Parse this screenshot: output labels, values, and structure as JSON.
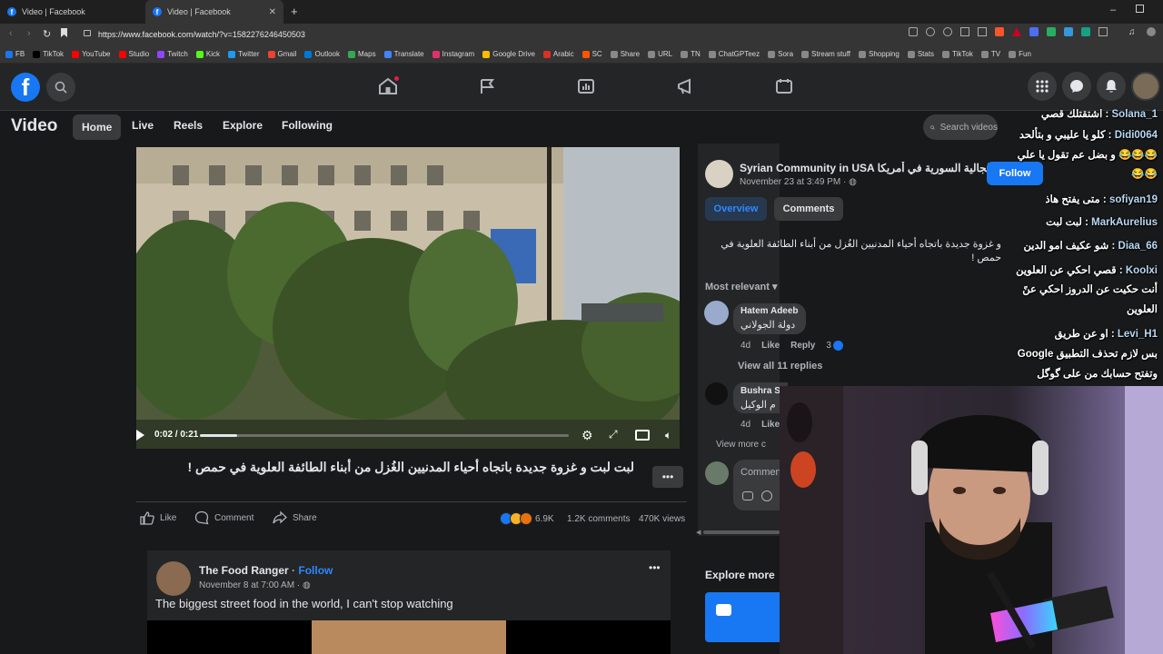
{
  "browser": {
    "tabs": [
      {
        "title": "Video | Facebook"
      },
      {
        "title": "Video | Facebook"
      }
    ],
    "url": "https://www.facebook.com/watch/?v=1582276246450503",
    "bookmarks": [
      "FB",
      "TikTok",
      "YouTube",
      "Studio",
      "Twitch",
      "Kick",
      "Twitter",
      "Gmail",
      "Outlook",
      "Maps",
      "Translate",
      "Instagram",
      "Google Drive",
      "Arabic",
      "SC",
      "Share",
      "URL",
      "TN",
      "ChatGPTeez",
      "Sora",
      "Stream stuff",
      "Shopping",
      "Stats",
      "TikTok",
      "TV",
      "Fun"
    ],
    "bookmark_colors": [
      "#1877f2",
      "#000000",
      "#ff0000",
      "#ff0000",
      "#9146ff",
      "#53fc18",
      "#1d9bf0",
      "#ea4335",
      "#0078d4",
      "#34a853",
      "#4285f4",
      "#e1306c",
      "#fbbc04",
      "#d93025",
      "#ff5500",
      "#888888",
      "#888888",
      "#888888",
      "#888888",
      "#888888",
      "#888888",
      "#888888",
      "#888888",
      "#888888",
      "#888888",
      "#888888"
    ]
  },
  "nav": {
    "page_title": "Video",
    "tabs": [
      "Home",
      "Live",
      "Reels",
      "Explore",
      "Following"
    ],
    "search_placeholder": "Search videos"
  },
  "video": {
    "time": "0:02 / 0:21",
    "progress": 0.1,
    "caption": "لبت لبت و غزوة جديدة باتجاه أحياء المدنيين الغُزل من أبناء الطائفة العلوية في حمص !",
    "actions": {
      "like": "Like",
      "comment": "Comment",
      "share": "Share"
    },
    "stats": {
      "reactions": "6.9K",
      "comments": "1.2K comments",
      "views": "470K views"
    }
  },
  "sidebar": {
    "page_name": "Syrian Community in USA الجالية السورية في أمريكا",
    "date": "November 23 at 3:49 PM · ",
    "follow": "Follow",
    "tabs": [
      "Overview",
      "Comments"
    ],
    "description": "و غزوة جديدة باتجاه أحياء المدنيين الغُزل من أبناء الطائفة العلوية في حمص !",
    "sort": "Most relevant",
    "comments": [
      {
        "author": "Hatem Adeeb",
        "text": "دولة الجولاني",
        "time": "4d",
        "like": "Like",
        "reply": "Reply",
        "reactions": "3",
        "view_replies": "View all 11 replies"
      },
      {
        "author": "Bushra Sl",
        "text": "م الوكيل",
        "time": "4d",
        "like": "Like",
        "reply": "",
        "reactions": "",
        "view_replies": "View more c"
      }
    ],
    "comment_placeholder": "Commen",
    "explore_title": "Explore more"
  },
  "post2": {
    "author": "The Food Ranger",
    "follow": "Follow",
    "date": "November 8 at 7:00 AM · ",
    "text": "The biggest street food in the world, I can't stop watching"
  },
  "chat": [
    {
      "user": "Solana_1",
      "msg": "اشتقتلك قصي"
    },
    {
      "user": "Didi0064",
      "msg": "كلو يا عليبي و بتألحد"
    },
    {
      "user": "",
      "msg": "😂😂😂 و بضل عم تقول يا علي"
    },
    {
      "user": "",
      "msg": "😂😂"
    },
    {
      "user": "sofiyan19",
      "msg": "متى يفتح هاذ"
    },
    {
      "user": "MarkAurelius",
      "msg": "لبت لبت"
    },
    {
      "user": "Diaa_66",
      "msg": "شو عكيف امو الدين"
    },
    {
      "user": "Koolxi",
      "msg": "قصي احكي عن العلوين"
    },
    {
      "user": "",
      "msg": "أنت حكيت عن الدروز احكي عنً"
    },
    {
      "user": "",
      "msg": "العلوين"
    },
    {
      "user": "Levi_H1",
      "msg": "او عن طريق"
    },
    {
      "user": "",
      "msg": "بس لازم تحذف التطبيق Google"
    },
    {
      "user": "",
      "msg": "وتفتح حسابك من على گوگل"
    }
  ],
  "colors": {
    "fb_blue": "#1877f2",
    "bg": "#18191a",
    "surface": "#242526",
    "chip": "#3a3b3c",
    "link": "#2d88ff"
  }
}
